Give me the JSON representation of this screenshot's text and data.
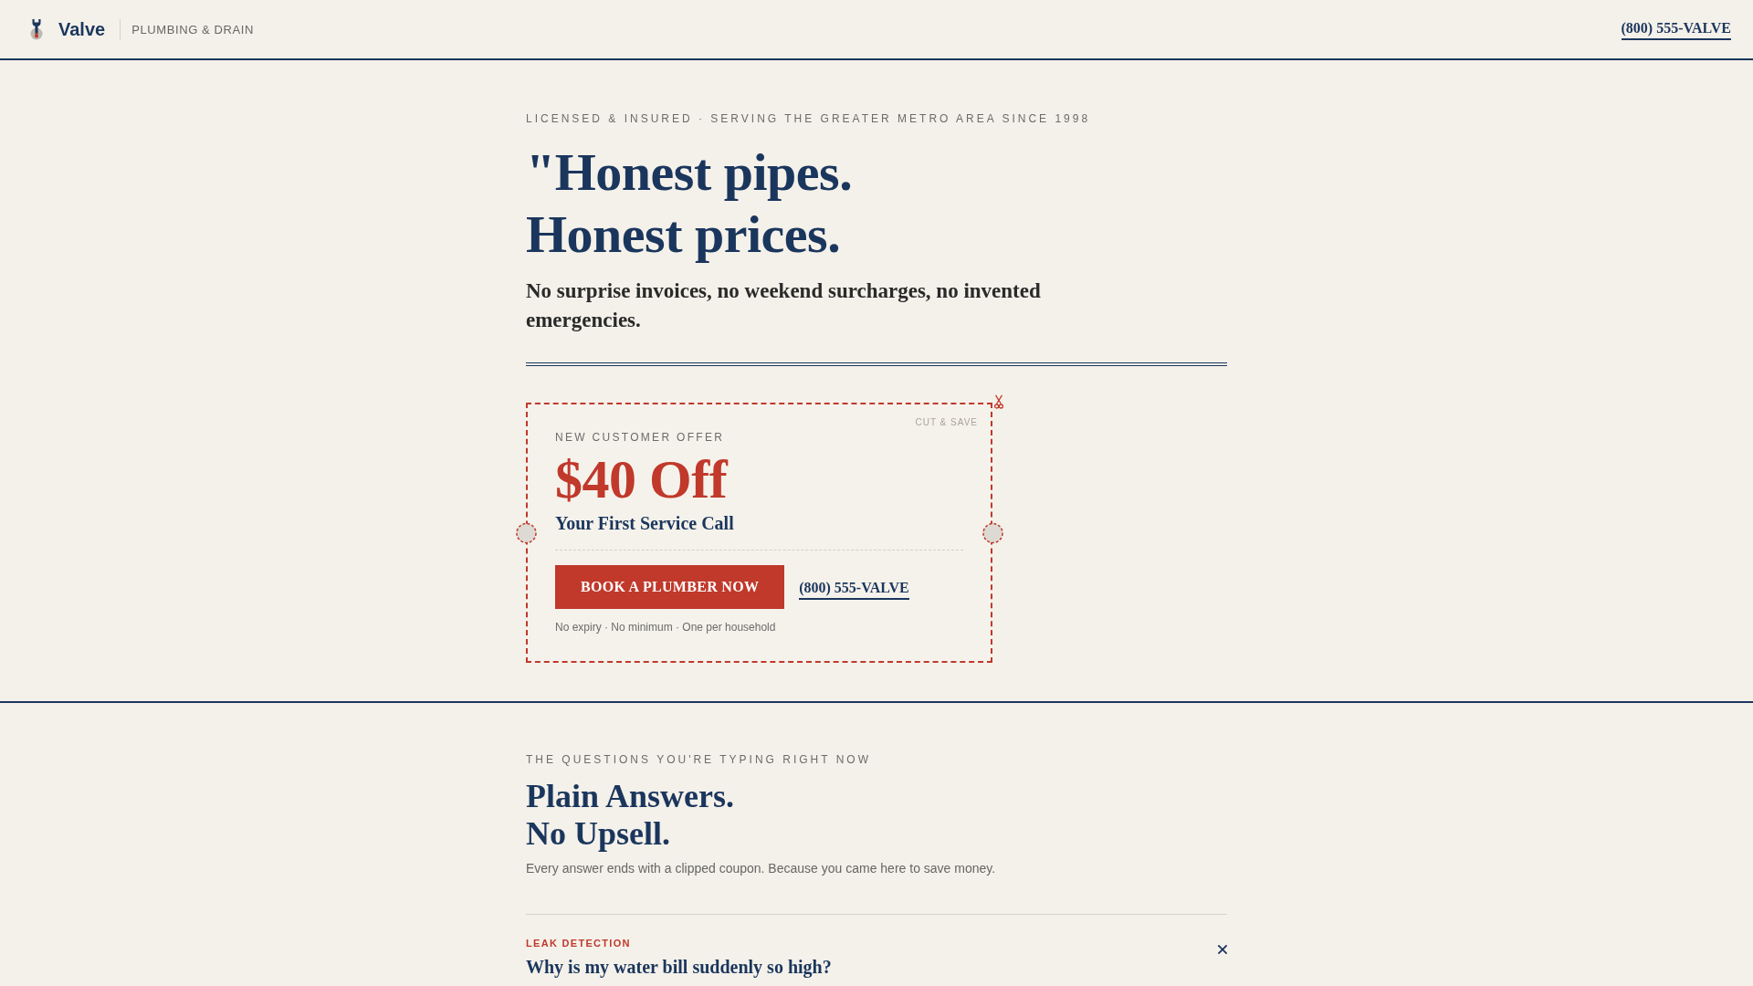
{
  "header": {
    "brand": "Valve",
    "tagline": "PLUMBING & DRAIN",
    "phone": "(800) 555-VALVE"
  },
  "hero": {
    "eyebrow": "LICENSED & INSURED · SERVING THE GREATER METRO AREA SINCE 1998",
    "headline": [
      "\"Honest pipes.",
      "Honest prices."
    ],
    "subheadline": "No surprise invoices, no weekend surcharges, no invented emergencies."
  },
  "coupon": {
    "corner_label": "CUT & SAVE",
    "eyebrow": "NEW CUSTOMER OFFER",
    "amount": "$40 Off",
    "title": "Your First Service Call",
    "button": "BOOK A PLUMBER NOW",
    "phone": "(800) 555-VALVE",
    "fine_print": "No expiry · No minimum · One per household"
  },
  "faq": {
    "eyebrow": "THE QUESTIONS YOU'RE TYPING RIGHT NOW",
    "heading": [
      "Plain Answers.",
      "No Upsell."
    ],
    "intro": "Every answer ends with a clipped coupon. Because you came here to save money.",
    "items": [
      {
        "category": "LEAK DETECTION",
        "question": "Why is my water bill suddenly so high?",
        "expanded": true
      }
    ]
  }
}
